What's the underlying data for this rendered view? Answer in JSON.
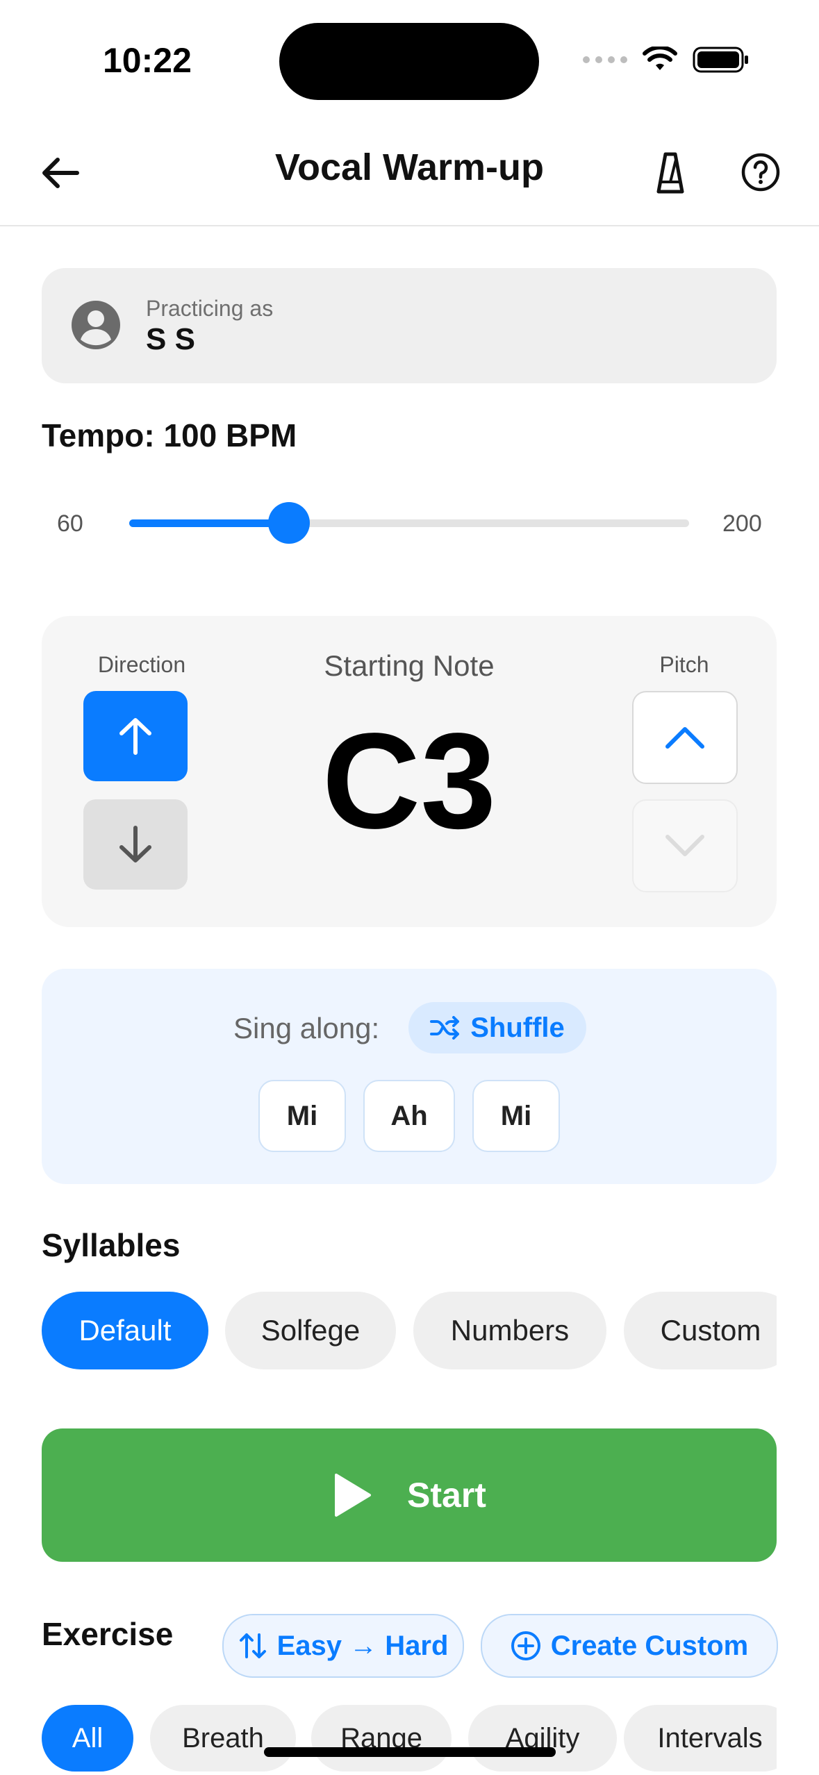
{
  "status_bar": {
    "time": "10:22"
  },
  "header": {
    "title": "Vocal Warm-up"
  },
  "practice": {
    "label": "Practicing as",
    "name": "S S"
  },
  "tempo": {
    "title": "Tempo: 100 BPM",
    "min": "60",
    "max": "200",
    "value": 100
  },
  "note_card": {
    "direction_label": "Direction",
    "starting_note_label": "Starting Note",
    "starting_note": "C3",
    "pitch_label": "Pitch"
  },
  "sing_along": {
    "label": "Sing along:",
    "shuffle_label": "Shuffle",
    "syllables": [
      "Mi",
      "Ah",
      "Mi"
    ]
  },
  "syllables": {
    "title": "Syllables",
    "options": [
      "Default",
      "Solfege",
      "Numbers",
      "Custom"
    ],
    "selected": "Default"
  },
  "start_button": {
    "label": "Start"
  },
  "exercise": {
    "title": "Exercise",
    "sort_label": "Easy → Hard",
    "create_label": "Create Custom",
    "categories": [
      "All",
      "Breath",
      "Range",
      "Agility",
      "Intervals"
    ],
    "selected": "All"
  },
  "colors": {
    "accent": "#0a7cff",
    "start_green": "#4caf50"
  }
}
